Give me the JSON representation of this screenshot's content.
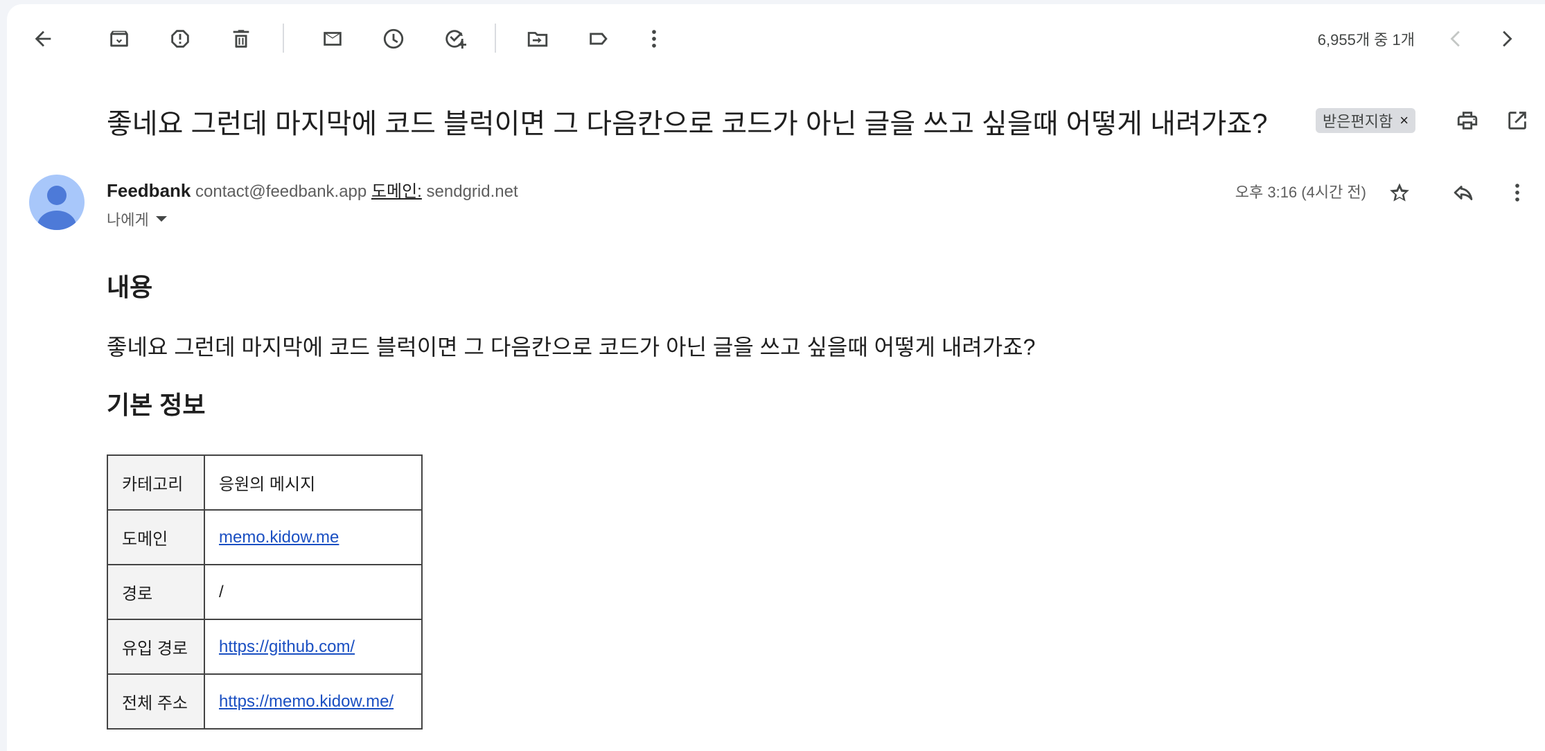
{
  "toolbar": {
    "counter": "6,955개 중 1개",
    "icons": [
      "back-arrow-icon",
      "archive-icon",
      "report-spam-icon",
      "delete-icon",
      "mark-unread-icon",
      "snooze-icon",
      "add-task-icon",
      "move-to-icon",
      "label-icon",
      "more-vert-icon",
      "prev-chevron-icon",
      "next-chevron-icon"
    ]
  },
  "message": {
    "subject": "좋네요 그런데 마지막에 코드 블럭이면 그 다음칸으로 코드가 아닌 글을 쓰고 싶을때 어떻게 내려가죠?",
    "label": "받은편지함",
    "label_remove": "×",
    "sender_name": "Feedbank",
    "sender_email": "contact@feedbank.app",
    "domain_label": "도메인:",
    "domain_value": "sendgrid.net",
    "to": "나에게",
    "date": "오후 3:16 (4시간 전)"
  },
  "body": {
    "section1_title": "내용",
    "content_text": "좋네요 그런데 마지막에 코드 블럭이면 그 다음칸으로 코드가 아닌 글을 쓰고 싶을때 어떻게 내려가죠?",
    "section2_title": "기본 정보",
    "table": [
      {
        "key": "카테고리",
        "value": "응원의 메시지",
        "link": false
      },
      {
        "key": "도메인",
        "value": "memo.kidow.me",
        "link": true
      },
      {
        "key": "경로",
        "value": "/",
        "link": false
      },
      {
        "key": "유입 경로",
        "value": "https://github.com/",
        "link": true
      },
      {
        "key": "전체 주소",
        "value": "https://memo.kidow.me/",
        "link": true
      }
    ]
  },
  "colors": {
    "link": "#1a4fc2",
    "avatar_bg": "#a8c7fa",
    "avatar_fg": "#4d7ad8",
    "chip_bg": "#dadce0"
  }
}
